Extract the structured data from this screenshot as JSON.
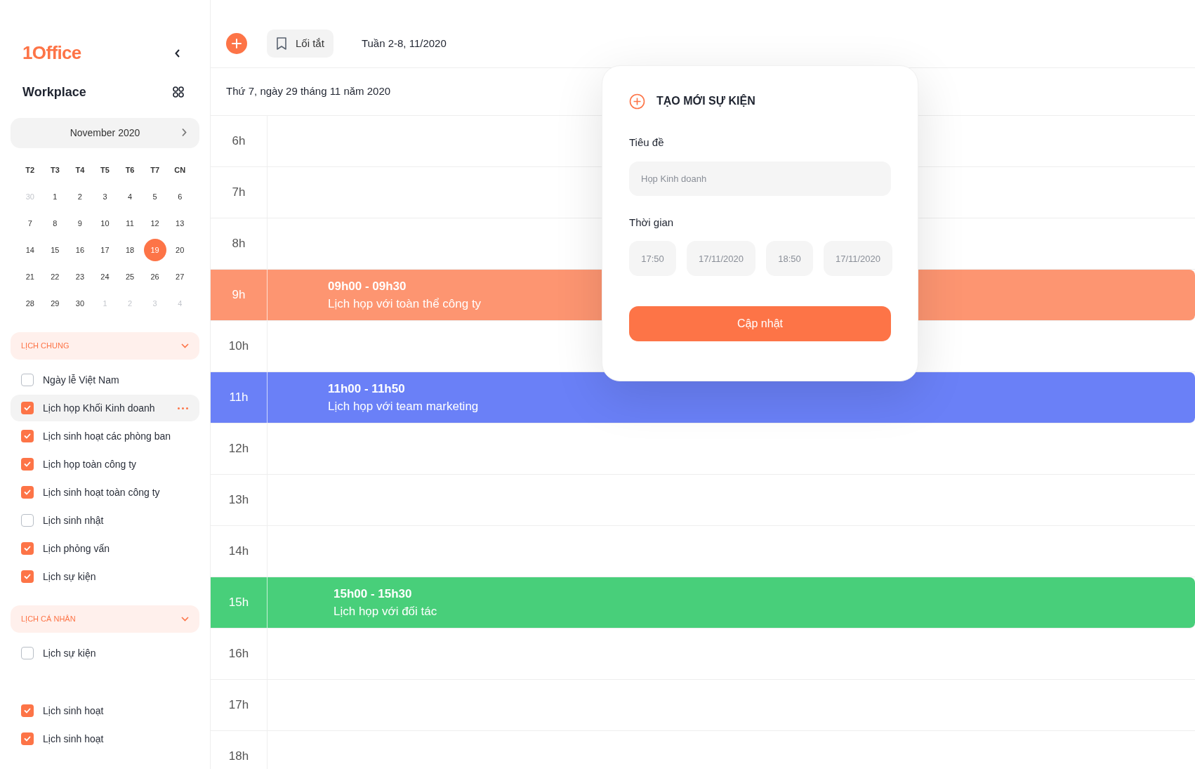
{
  "sidebar": {
    "logo": "1Office",
    "workspace": "Workplace",
    "calendar": {
      "month": "November 2020",
      "weekdays": [
        "T2",
        "T3",
        "T4",
        "T5",
        "T6",
        "T7",
        "CN"
      ],
      "days": [
        {
          "label": "30",
          "outside": true,
          "selected": false
        },
        {
          "label": "1",
          "outside": false,
          "selected": false
        },
        {
          "label": "2",
          "outside": false,
          "selected": false
        },
        {
          "label": "3",
          "outside": false,
          "selected": false
        },
        {
          "label": "4",
          "outside": false,
          "selected": false
        },
        {
          "label": "5",
          "outside": false,
          "selected": false
        },
        {
          "label": "6",
          "outside": false,
          "selected": false
        },
        {
          "label": "7",
          "outside": false,
          "selected": false
        },
        {
          "label": "8",
          "outside": false,
          "selected": false
        },
        {
          "label": "9",
          "outside": false,
          "selected": false
        },
        {
          "label": "10",
          "outside": false,
          "selected": false
        },
        {
          "label": "11",
          "outside": false,
          "selected": false
        },
        {
          "label": "12",
          "outside": false,
          "selected": false
        },
        {
          "label": "13",
          "outside": false,
          "selected": false
        },
        {
          "label": "14",
          "outside": false,
          "selected": false
        },
        {
          "label": "15",
          "outside": false,
          "selected": false
        },
        {
          "label": "16",
          "outside": false,
          "selected": false
        },
        {
          "label": "17",
          "outside": false,
          "selected": false
        },
        {
          "label": "18",
          "outside": false,
          "selected": false
        },
        {
          "label": "19",
          "outside": false,
          "selected": true
        },
        {
          "label": "20",
          "outside": false,
          "selected": false
        },
        {
          "label": "21",
          "outside": false,
          "selected": false
        },
        {
          "label": "22",
          "outside": false,
          "selected": false
        },
        {
          "label": "23",
          "outside": false,
          "selected": false
        },
        {
          "label": "24",
          "outside": false,
          "selected": false
        },
        {
          "label": "25",
          "outside": false,
          "selected": false
        },
        {
          "label": "26",
          "outside": false,
          "selected": false
        },
        {
          "label": "27",
          "outside": false,
          "selected": false
        },
        {
          "label": "28",
          "outside": false,
          "selected": false
        },
        {
          "label": "29",
          "outside": false,
          "selected": false
        },
        {
          "label": "30",
          "outside": false,
          "selected": false
        },
        {
          "label": "1",
          "outside": true,
          "selected": false
        },
        {
          "label": "2",
          "outside": true,
          "selected": false
        },
        {
          "label": "3",
          "outside": true,
          "selected": false
        },
        {
          "label": "4",
          "outside": true,
          "selected": false
        }
      ]
    },
    "groups": [
      {
        "title": "LỊCH CHUNG",
        "expanded": true,
        "items": [
          {
            "label": "Ngày lễ Việt Nam",
            "checked": false,
            "selected": false
          },
          {
            "label": "Lịch họp Khối Kinh doanh",
            "checked": true,
            "selected": true
          },
          {
            "label": "Lịch sinh hoạt các phòng ban",
            "checked": true,
            "selected": false
          },
          {
            "label": "Lịch họp toàn công ty",
            "checked": true,
            "selected": false
          },
          {
            "label": "Lịch sinh hoạt toàn công ty",
            "checked": true,
            "selected": false
          },
          {
            "label": "Lịch sinh nhật",
            "checked": false,
            "selected": false
          },
          {
            "label": "Lịch phỏng vấn",
            "checked": true,
            "selected": false
          },
          {
            "label": "Lịch sự kiện",
            "checked": true,
            "selected": false
          }
        ]
      },
      {
        "title": "LỊCH CÁ NHÂN",
        "expanded": true,
        "items": [
          {
            "label": "Lịch sự kiện",
            "checked": false,
            "selected": false
          },
          {
            "label": "Lịch sinh hoạt",
            "checked": true,
            "selected": false
          },
          {
            "label": "Lịch sinh hoạt",
            "checked": true,
            "selected": false
          }
        ]
      }
    ]
  },
  "toolbar": {
    "shortcut": "Lối tắt",
    "week": "Tuần 2-8, 11/2020"
  },
  "date": "Thứ 7, ngày 29 tháng 11 năm 2020",
  "hours": [
    {
      "label": "6h"
    },
    {
      "label": "7h"
    },
    {
      "label": "8h"
    },
    {
      "label": "9h",
      "event": {
        "time": "09h00 - 09h30",
        "title": "Lịch họp với toàn thể công ty",
        "color": "#fd9571"
      }
    },
    {
      "label": "10h"
    },
    {
      "label": "11h",
      "event": {
        "time": "11h00 - 11h50",
        "title": "Lịch họp với team marketing",
        "color": "#6a80f7"
      }
    },
    {
      "label": "12h"
    },
    {
      "label": "13h"
    },
    {
      "label": "14h"
    },
    {
      "label": "15h",
      "event": {
        "time": "15h00 - 15h30",
        "title": "Lịch họp với đối tác",
        "color": "#48cf7a"
      }
    },
    {
      "label": "16h"
    },
    {
      "label": "17h"
    },
    {
      "label": "18h"
    }
  ],
  "dialog": {
    "title": "TẠO MỚI SỰ KIỆN",
    "title_label": "Tiêu đề",
    "title_placeholder": "Họp Kinh doanh",
    "time_label": "Thời gian",
    "times": [
      {
        "placeholder": "17:50"
      },
      {
        "placeholder": "17/11/2020"
      },
      {
        "placeholder": "18:50"
      },
      {
        "placeholder": "17/11/2020"
      }
    ],
    "submit": "Cập nhật"
  }
}
